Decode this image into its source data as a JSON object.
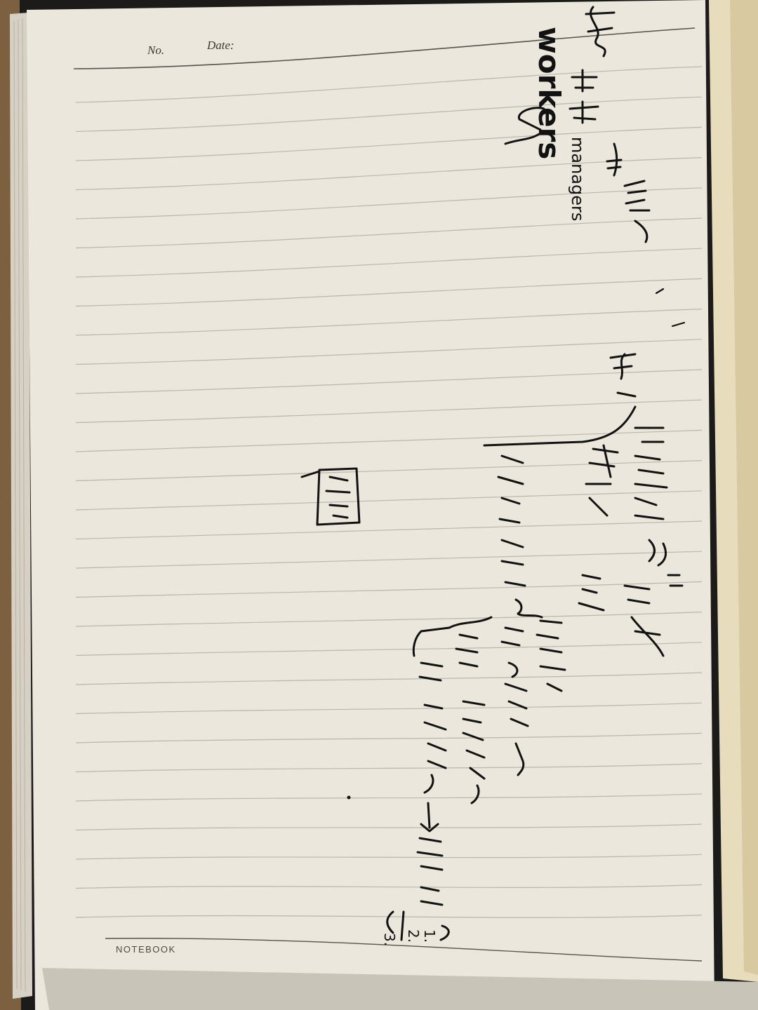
{
  "header": {
    "number_label": "No.",
    "date_label": "Date:"
  },
  "footer": {
    "brand": "NOTEBOOK"
  },
  "handwriting": {
    "workers": "workers",
    "managers": "managers",
    "list_numbers": [
      "1.",
      "2.",
      "3."
    ]
  },
  "colors": {
    "paper": "#ebe7dc",
    "rule_line": "#b9b6ad",
    "ink": "#121212",
    "background": "#1c1b19",
    "cardboard": "#8a6a45"
  }
}
